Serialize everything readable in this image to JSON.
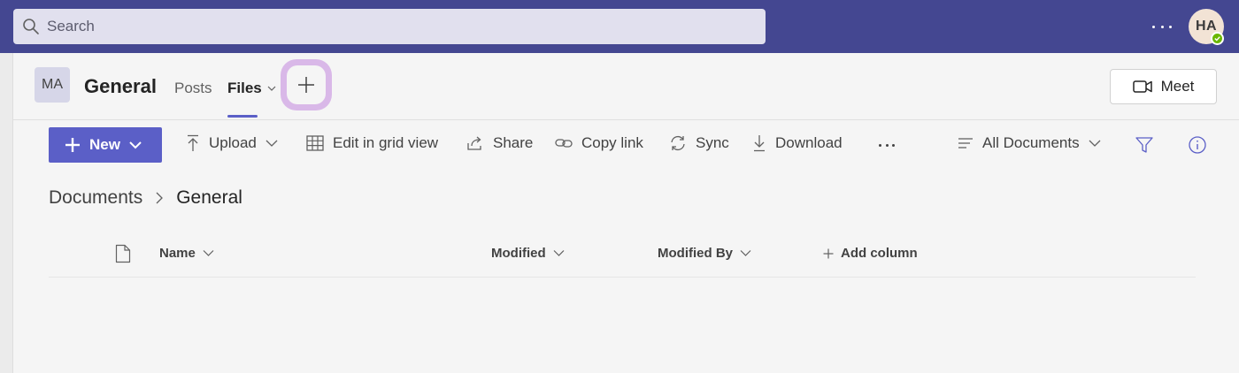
{
  "search": {
    "placeholder": "Search"
  },
  "user": {
    "initials": "HA"
  },
  "channel": {
    "team_initials": "MA",
    "name": "General",
    "tabs": [
      {
        "label": "Posts",
        "active": false
      },
      {
        "label": "Files",
        "active": true
      }
    ],
    "meet_label": "Meet"
  },
  "commands": {
    "new": "New",
    "upload": "Upload",
    "edit_grid": "Edit in grid view",
    "share": "Share",
    "copy_link": "Copy link",
    "sync": "Sync",
    "download": "Download",
    "view": "All Documents"
  },
  "breadcrumb": {
    "root": "Documents",
    "current": "General"
  },
  "columns": {
    "name": "Name",
    "modified": "Modified",
    "modified_by": "Modified By",
    "add_column": "Add column"
  },
  "colors": {
    "topbar": "#444791",
    "accent": "#5b5fc7",
    "add_tab_highlight": "#d9b8e8",
    "presence": "#6bb700"
  }
}
